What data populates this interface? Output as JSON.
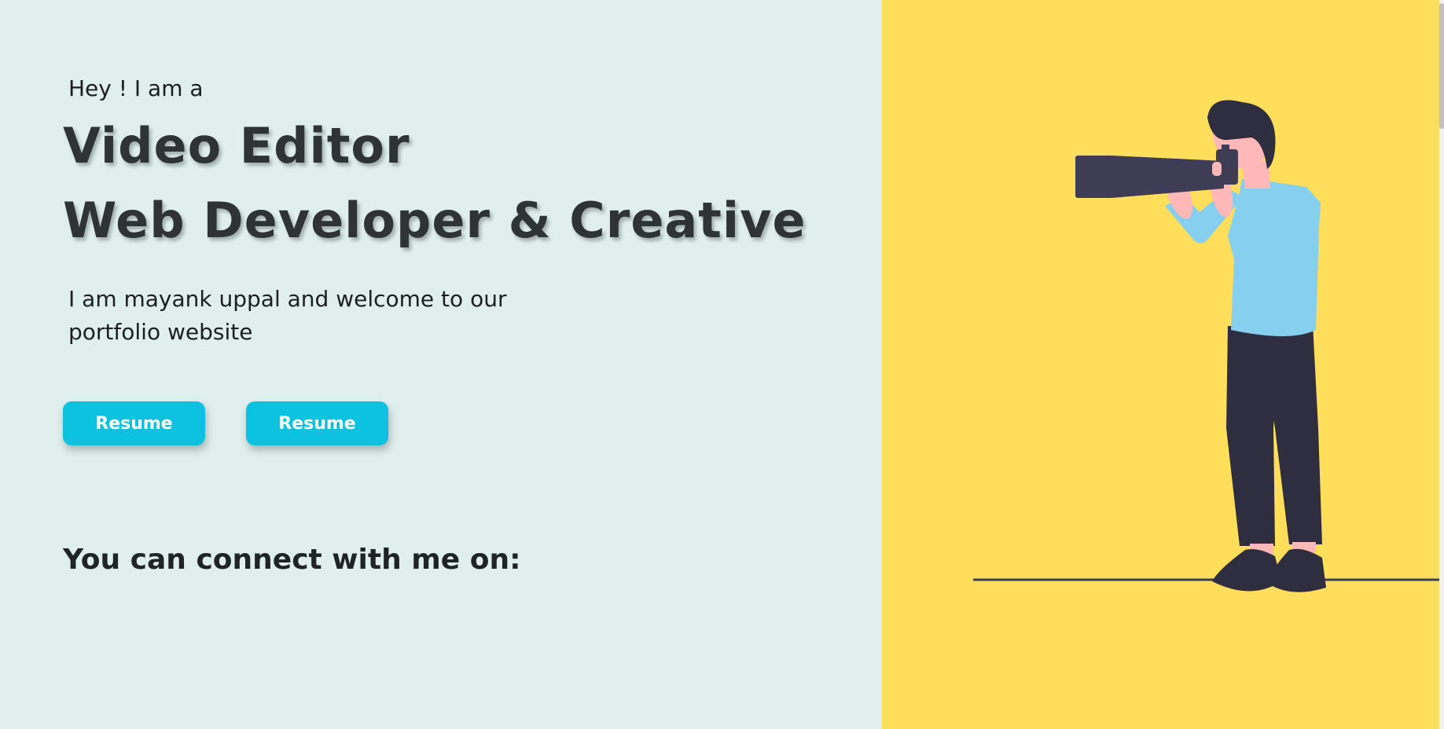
{
  "hero": {
    "greeting": "Hey ! I am a",
    "headline_line1": "Video Editor",
    "headline_line2": "Web Developer & Creative",
    "intro": "I am mayank uppal and welcome to our portfolio website",
    "buttons": [
      {
        "label": "Resume"
      },
      {
        "label": "Resume"
      }
    ],
    "connect_heading": "You can connect with me on:"
  },
  "illustration": {
    "subject": "photographer-with-telephoto-camera",
    "colors": {
      "background": "#fede5b",
      "shirt": "#87cfee",
      "pants": "#2f2e41",
      "skin": "#ffb8b8",
      "hair": "#2f2e41",
      "camera": "#3f3d56"
    }
  },
  "theme": {
    "left_background": "#e0efee",
    "accent": "#0cc2df",
    "text": "#2e3336"
  }
}
